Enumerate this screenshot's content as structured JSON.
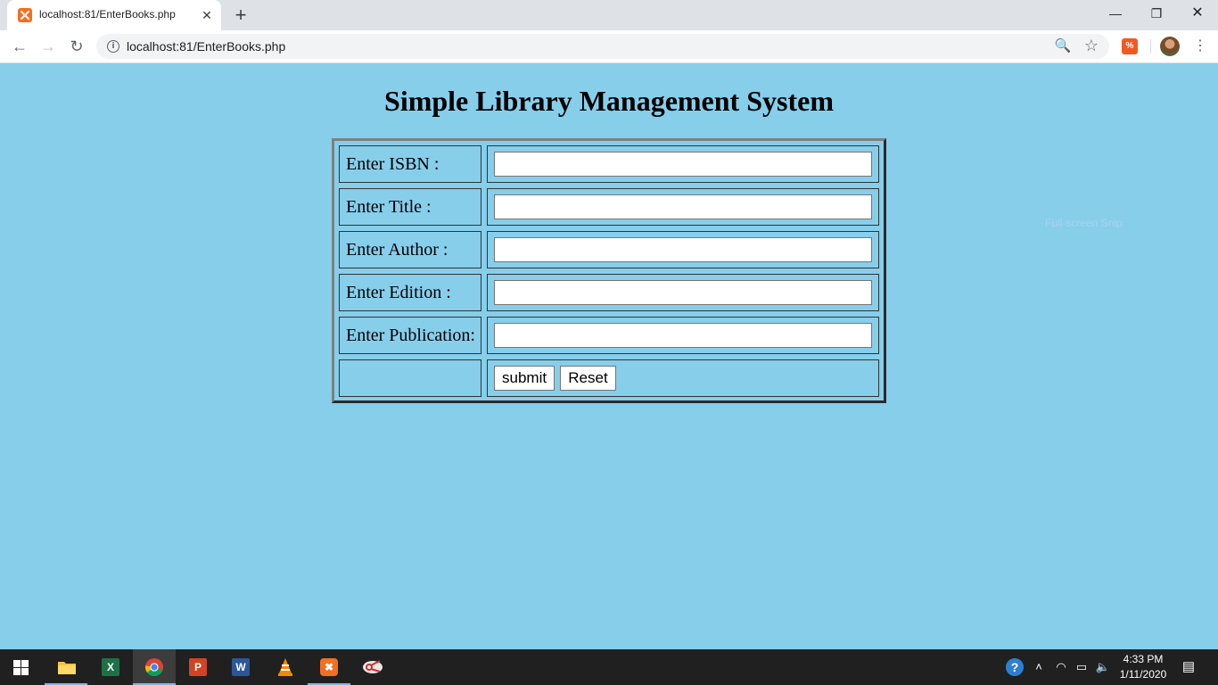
{
  "browser": {
    "tab_title": "localhost:81/EnterBooks.php",
    "tab_close_glyph": "✕",
    "new_tab_glyph": "+",
    "url": "localhost:81/EnterBooks.php",
    "window_controls": {
      "minimize": "—",
      "maximize": "❐",
      "close": "✕"
    },
    "nav": {
      "back": "←",
      "forward": "→",
      "reload": "↻"
    },
    "icons": {
      "info": "i",
      "zoom": "🔍",
      "star": "☆",
      "menu": "⋮"
    }
  },
  "page": {
    "title": "Simple Library Management System",
    "background_color": "#87ceeb",
    "form": {
      "rows": [
        {
          "label": "Enter ISBN :",
          "value": ""
        },
        {
          "label": "Enter Title :",
          "value": ""
        },
        {
          "label": "Enter Author :",
          "value": ""
        },
        {
          "label": "Enter Edition :",
          "value": ""
        },
        {
          "label": "Enter Publication:",
          "value": ""
        }
      ],
      "submit_label": "submit",
      "reset_label": "Reset"
    },
    "overlay_text": "Full-screen Snip"
  },
  "taskbar": {
    "apps": [
      {
        "name": "start",
        "icon": "windows-icon"
      },
      {
        "name": "file-explorer",
        "icon": "folder-icon",
        "color": "#f5c342"
      },
      {
        "name": "excel",
        "icon": "excel-icon",
        "color": "#1e7145"
      },
      {
        "name": "chrome",
        "icon": "chrome-icon",
        "active": true
      },
      {
        "name": "powerpoint",
        "icon": "powerpoint-icon",
        "color": "#d04423"
      },
      {
        "name": "word",
        "icon": "word-icon",
        "color": "#2b579a"
      },
      {
        "name": "vlc",
        "icon": "vlc-icon",
        "color": "#f08c00"
      },
      {
        "name": "xampp",
        "icon": "xampp-icon",
        "color": "#f37021"
      },
      {
        "name": "snipping-tool",
        "icon": "snip-icon"
      }
    ],
    "tray": {
      "help_glyph": "?",
      "time": "4:33 PM",
      "date": "1/11/2020"
    }
  }
}
